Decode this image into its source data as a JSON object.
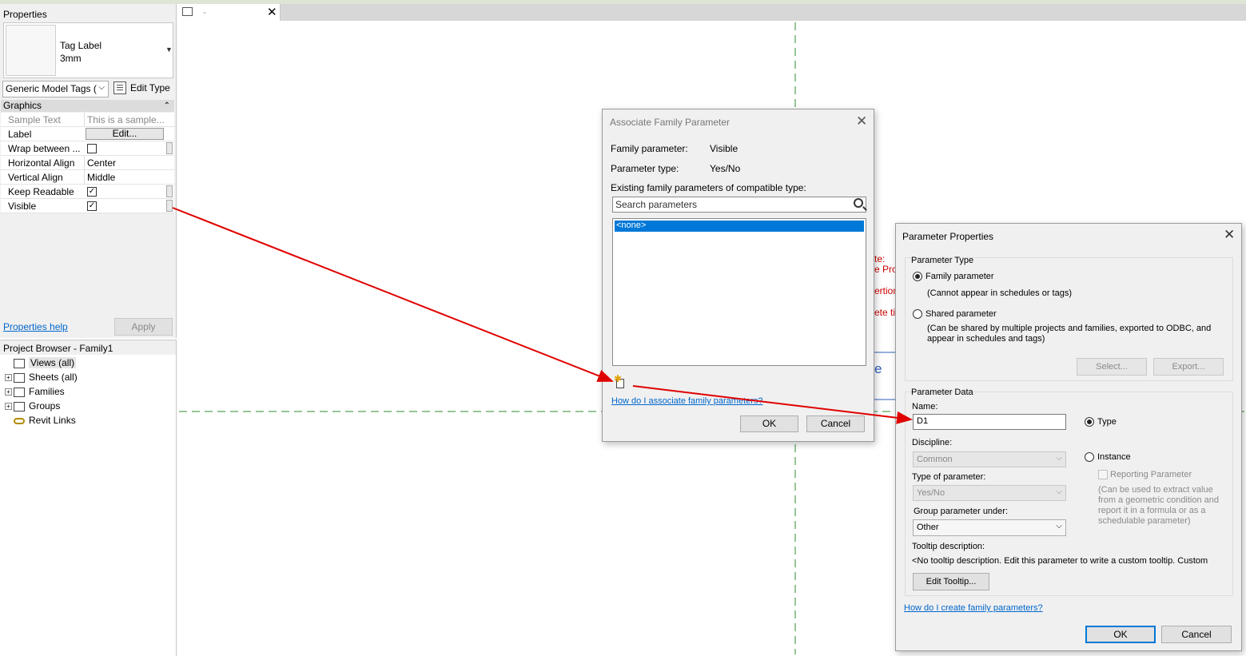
{
  "properties": {
    "title": "Properties",
    "type_name_line1": "Tag Label",
    "type_name_line2": "3mm",
    "family_select": "Generic Model Tags (",
    "edit_type": "Edit Type",
    "group_graphics": "Graphics",
    "rows": [
      {
        "label": "Sample Text",
        "value": "This is a sample..."
      },
      {
        "label": "Label",
        "value": "Edit..."
      },
      {
        "label": "Wrap between ...",
        "value": ""
      },
      {
        "label": "Horizontal Align",
        "value": "Center"
      },
      {
        "label": "Vertical Align",
        "value": "Middle"
      },
      {
        "label": "Keep Readable",
        "value": "checked"
      },
      {
        "label": "Visible",
        "value": "checked"
      }
    ],
    "help_link": "Properties help",
    "apply": "Apply"
  },
  "browser": {
    "title": "Project Browser - Family1",
    "items": [
      "Views (all)",
      "Sheets (all)",
      "Families",
      "Groups",
      "Revit Links"
    ]
  },
  "tab": {
    "label": "-",
    "close": "✕"
  },
  "assoc_dialog": {
    "title": "Associate Family Parameter",
    "family_param_label": "Family parameter:",
    "family_param_value": "Visible",
    "param_type_label": "Parameter type:",
    "param_type_value": "Yes/No",
    "existing_label": "Existing family parameters of compatible type:",
    "search_placeholder": "Search parameters",
    "list_item": "<none>",
    "help_link": "How do I associate family parameters?",
    "ok": "OK",
    "cancel": "Cancel"
  },
  "bg_red_fragments": [
    "te:",
    "e Pro",
    "ertion",
    "ete ti"
  ],
  "bg_blue_fragment": "e",
  "param_dialog": {
    "title": "Parameter Properties",
    "param_type_group": "Parameter Type",
    "family_param": "Family parameter",
    "family_param_note": "(Cannot appear in schedules or tags)",
    "shared_param": "Shared parameter",
    "shared_param_note1": "(Can be shared by multiple projects and families, exported to ODBC, and",
    "shared_param_note2": "appear in schedules and tags)",
    "select_btn": "Select...",
    "export_btn": "Export...",
    "param_data_group": "Parameter Data",
    "name_label": "Name:",
    "name_value": "D1",
    "type_radio": "Type",
    "instance_radio": "Instance",
    "discipline_label": "Discipline:",
    "discipline_value": "Common",
    "reporting_param": "Reporting Parameter",
    "reporting_note": [
      "(Can be used to extract value",
      "from a geometric condition and",
      "report it in a formula or as a",
      "schedulable parameter)"
    ],
    "type_of_param_label": "Type of parameter:",
    "type_of_param_value": "Yes/No",
    "group_under_label": "Group parameter under:",
    "group_under_value": "Other",
    "tooltip_label": "Tooltip description:",
    "tooltip_text": "<No tooltip description. Edit this parameter to write a custom tooltip. Custom",
    "edit_tooltip_btn": "Edit Tooltip...",
    "help_link": "How do I create family parameters?",
    "ok": "OK",
    "cancel": "Cancel"
  },
  "colors": {
    "arrow": "#e00000",
    "selection": "#0078d7",
    "link": "#0066cc",
    "guide": "#2e8b2e"
  }
}
